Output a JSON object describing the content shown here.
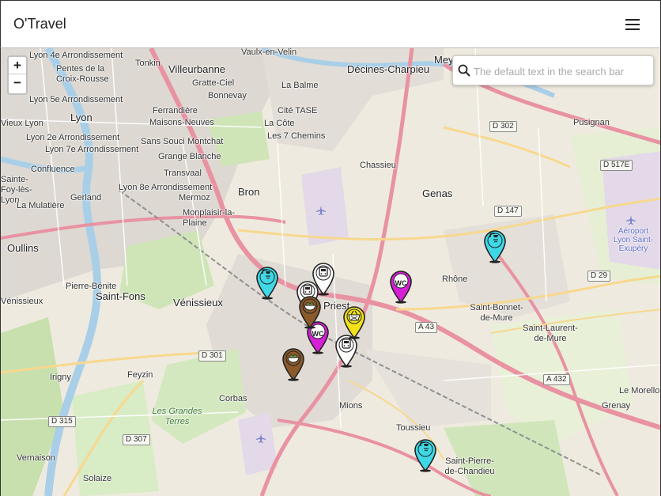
{
  "app": {
    "title": "O'Travel",
    "menu_icon": "hamburger-menu-icon"
  },
  "search": {
    "placeholder": "The default text in the search bar",
    "value": "",
    "icon": "search-icon"
  },
  "zoom": {
    "in_label": "+",
    "out_label": "−"
  },
  "map": {
    "cities": [
      "Villeurbanne",
      "Décines-Charpieu",
      "Lyon",
      "Bron",
      "Genas",
      "Oullins",
      "Saint-Fons",
      "Vénissieux",
      "Priest",
      "Mions",
      "Corbas",
      "Feyzin",
      "Irigny",
      "Meyzieu"
    ],
    "districts": [
      "Vaulx-en-Velin",
      "Lyon 4e Arrondissement",
      "Pentes de la Croix-Rousse",
      "Lyon 5e Arrondissement",
      "Lyon 2e Arrondissement",
      "Lyon 7e Arrondissement",
      "Lyon 8e Arrondissement",
      "Tonkin",
      "Gratte-Ciel",
      "Bonnevay",
      "Ferrandière",
      "Maisons-Neuves",
      "Sans Souci",
      "Montchat",
      "Grange Blanche",
      "Transvaal",
      "Mermoz",
      "Monplaisir-la-Plaine",
      "Confluence",
      "Gerland",
      "La Mulatière",
      "La Balme",
      "Cité TASE",
      "La Côte",
      "Les 7 Chemins",
      "Chassieu",
      "Pusignan",
      "Saint-Bonnet-de-Mure",
      "Saint-Laurent-de-Mure",
      "Le Morellon",
      "Grenay",
      "Toussieu",
      "Saint-Pierre-de-Chandieu",
      "Solaize",
      "Vernaison",
      "Pierre-Bénite",
      "Sainte-Foy-lès-Lyon",
      "Vénissieux",
      "Rhône",
      "Vieux Lyon",
      "Saint-Priest"
    ],
    "park_label": "Les Grandes Terres",
    "airport_label": "Aéroport Lyon Saint-Exupéry",
    "roads": [
      "D 302",
      "D 517E",
      "D 147",
      "D 29",
      "A 43",
      "A 432",
      "D 301",
      "D 315",
      "D 307"
    ]
  },
  "markers": [
    {
      "type": "shower",
      "color": "#3fd8e6",
      "icon": "shower-icon"
    },
    {
      "type": "shower",
      "color": "#3fd8e6",
      "icon": "shower-icon"
    },
    {
      "type": "shower",
      "color": "#3fd8e6",
      "icon": "shower-icon"
    },
    {
      "type": "toilet",
      "color": "#d61fd6",
      "icon": "wc-icon",
      "text": "WC"
    },
    {
      "type": "toilet",
      "color": "#d61fd6",
      "icon": "wc-icon",
      "text": "WC"
    },
    {
      "type": "train",
      "color": "#ffffff",
      "icon": "train-icon"
    },
    {
      "type": "train",
      "color": "#ffffff",
      "icon": "train-icon"
    },
    {
      "type": "train",
      "color": "#ffffff",
      "icon": "train-icon"
    },
    {
      "type": "food",
      "color": "#8b5a2b",
      "icon": "food-bowl-icon"
    },
    {
      "type": "food",
      "color": "#8b5a2b",
      "icon": "food-bowl-icon"
    },
    {
      "type": "basket",
      "color": "#f1e21a",
      "icon": "basket-icon"
    }
  ]
}
